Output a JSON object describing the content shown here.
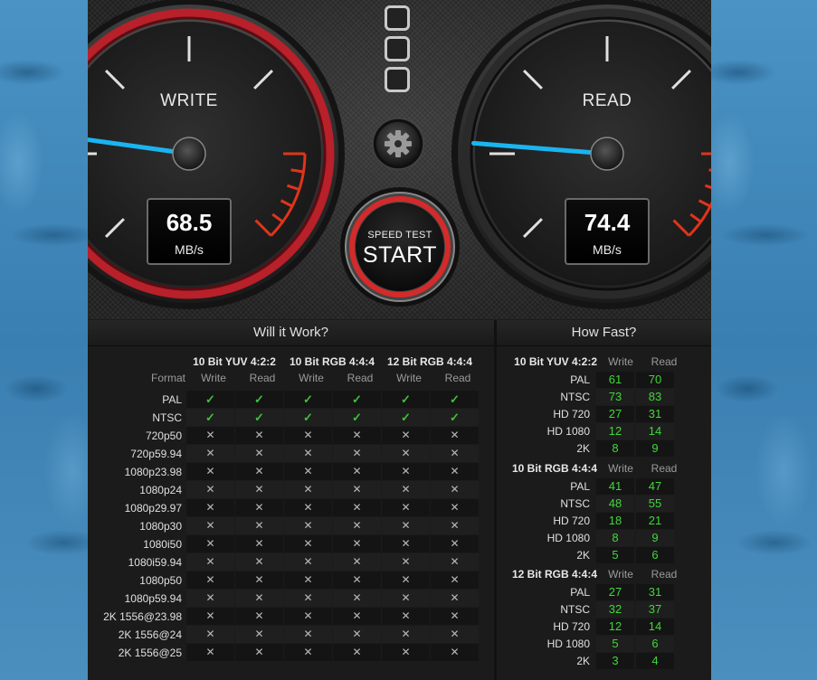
{
  "write_gauge": {
    "label": "WRITE",
    "value": "68.5",
    "unit": "MB/s",
    "needle_level": 0.23
  },
  "read_gauge": {
    "label": "READ",
    "value": "74.4",
    "unit": "MB/s",
    "needle_level": 0.25
  },
  "start_button": {
    "caption": "SPEED TEST",
    "label": "START"
  },
  "will_it_work": {
    "title": "Will it Work?",
    "format_label": "Format",
    "groups": [
      "10 Bit YUV 4:2:2",
      "10 Bit RGB 4:4:4",
      "12 Bit RGB 4:4:4"
    ],
    "sub_headers": [
      "Write",
      "Read"
    ],
    "check_glyph": "✓",
    "cross_glyph": "✕",
    "rows": [
      {
        "format": "PAL",
        "results": [
          true,
          true,
          true,
          true,
          true,
          true
        ]
      },
      {
        "format": "NTSC",
        "results": [
          true,
          true,
          true,
          true,
          true,
          true
        ]
      },
      {
        "format": "720p50",
        "results": [
          false,
          false,
          false,
          false,
          false,
          false
        ]
      },
      {
        "format": "720p59.94",
        "results": [
          false,
          false,
          false,
          false,
          false,
          false
        ]
      },
      {
        "format": "1080p23.98",
        "results": [
          false,
          false,
          false,
          false,
          false,
          false
        ]
      },
      {
        "format": "1080p24",
        "results": [
          false,
          false,
          false,
          false,
          false,
          false
        ]
      },
      {
        "format": "1080p29.97",
        "results": [
          false,
          false,
          false,
          false,
          false,
          false
        ]
      },
      {
        "format": "1080p30",
        "results": [
          false,
          false,
          false,
          false,
          false,
          false
        ]
      },
      {
        "format": "1080i50",
        "results": [
          false,
          false,
          false,
          false,
          false,
          false
        ]
      },
      {
        "format": "1080i59.94",
        "results": [
          false,
          false,
          false,
          false,
          false,
          false
        ]
      },
      {
        "format": "1080p50",
        "results": [
          false,
          false,
          false,
          false,
          false,
          false
        ]
      },
      {
        "format": "1080p59.94",
        "results": [
          false,
          false,
          false,
          false,
          false,
          false
        ]
      },
      {
        "format": "2K 1556@23.98",
        "results": [
          false,
          false,
          false,
          false,
          false,
          false
        ]
      },
      {
        "format": "2K 1556@24",
        "results": [
          false,
          false,
          false,
          false,
          false,
          false
        ]
      },
      {
        "format": "2K 1556@25",
        "results": [
          false,
          false,
          false,
          false,
          false,
          false
        ]
      }
    ]
  },
  "how_fast": {
    "title": "How Fast?",
    "col_write": "Write",
    "col_read": "Read",
    "blocks": [
      {
        "title": "10 Bit YUV 4:2:2",
        "rows": [
          {
            "format": "PAL",
            "write": "61",
            "read": "70"
          },
          {
            "format": "NTSC",
            "write": "73",
            "read": "83"
          },
          {
            "format": "HD 720",
            "write": "27",
            "read": "31"
          },
          {
            "format": "HD 1080",
            "write": "12",
            "read": "14"
          },
          {
            "format": "2K",
            "write": "8",
            "read": "9"
          }
        ]
      },
      {
        "title": "10 Bit RGB 4:4:4",
        "rows": [
          {
            "format": "PAL",
            "write": "41",
            "read": "47"
          },
          {
            "format": "NTSC",
            "write": "48",
            "read": "55"
          },
          {
            "format": "HD 720",
            "write": "18",
            "read": "21"
          },
          {
            "format": "HD 1080",
            "write": "8",
            "read": "9"
          },
          {
            "format": "2K",
            "write": "5",
            "read": "6"
          }
        ]
      },
      {
        "title": "12 Bit RGB 4:4:4",
        "rows": [
          {
            "format": "PAL",
            "write": "27",
            "read": "31"
          },
          {
            "format": "NTSC",
            "write": "32",
            "read": "37"
          },
          {
            "format": "HD 720",
            "write": "12",
            "read": "14"
          },
          {
            "format": "HD 1080",
            "write": "5",
            "read": "6"
          },
          {
            "format": "2K",
            "write": "3",
            "read": "4"
          }
        ]
      }
    ]
  },
  "colors": {
    "needle": "#1ab4f0",
    "write_ring": "#b8202a",
    "danger_ticks": "#e0341a",
    "check": "#3ec23e",
    "fast_value": "#41d63b"
  }
}
